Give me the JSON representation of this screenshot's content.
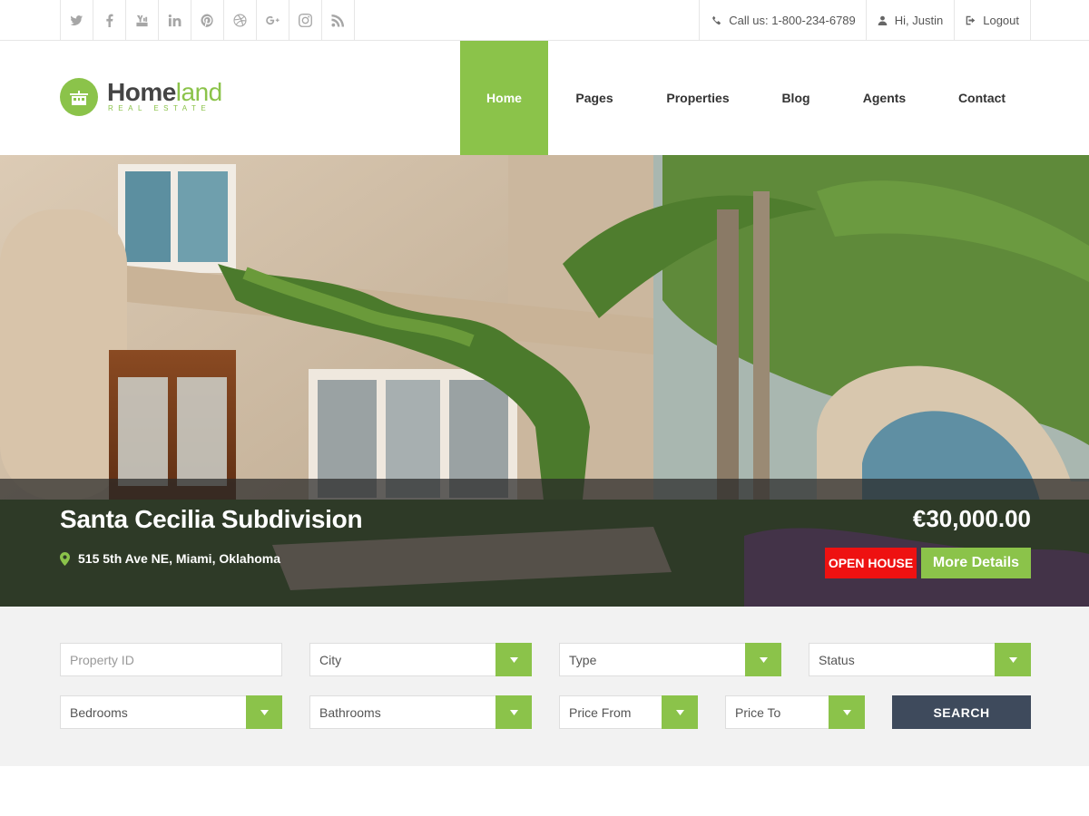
{
  "topbar": {
    "social": [
      "twitter-icon",
      "facebook-icon",
      "youtube-icon",
      "linkedin-icon",
      "pinterest-icon",
      "dribbble-icon",
      "google-plus-icon",
      "instagram-icon",
      "rss-icon"
    ],
    "phone": "Call us: 1-800-234-6789",
    "greeting": "Hi, Justin",
    "logout": "Logout"
  },
  "logo": {
    "name_bold": "Home",
    "name_light": "land",
    "tagline": "REAL ESTATE"
  },
  "nav": {
    "items": [
      {
        "label": "Home",
        "active": true
      },
      {
        "label": "Pages",
        "active": false
      },
      {
        "label": "Properties",
        "active": false
      },
      {
        "label": "Blog",
        "active": false
      },
      {
        "label": "Agents",
        "active": false
      },
      {
        "label": "Contact",
        "active": false
      }
    ]
  },
  "hero": {
    "title": "Santa Cecilia Subdivision",
    "address": "515 5th Ave NE, Miami, Oklahoma",
    "price": "€30,000.00",
    "badge": "OPEN HOUSE",
    "more_details": "More Details"
  },
  "search": {
    "property_id_placeholder": "Property ID",
    "city": "City",
    "type": "Type",
    "status": "Status",
    "bedrooms": "Bedrooms",
    "bathrooms": "Bathrooms",
    "price_from": "Price From",
    "price_to": "Price To",
    "search_label": "SEARCH"
  },
  "colors": {
    "accent": "#8bc34a",
    "badge_red": "#ee1111",
    "search_button": "#3e4a5c",
    "search_bg": "#f2f2f2"
  }
}
